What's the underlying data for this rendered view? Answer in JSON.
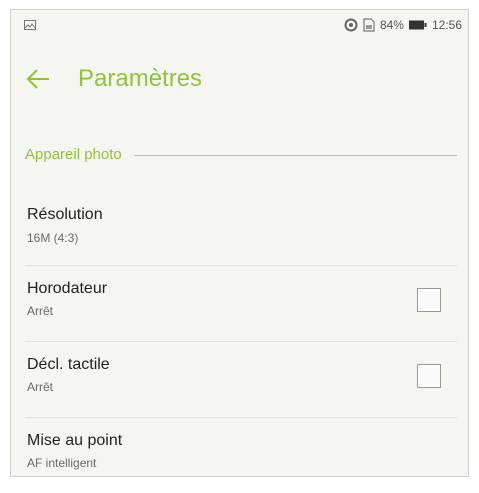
{
  "status_bar": {
    "battery_percent": "84%",
    "time": "12:56",
    "icons": [
      "image-notification-icon",
      "sync-icon",
      "sim-icon",
      "battery-icon"
    ]
  },
  "toolbar": {
    "title": "Paramètres",
    "back_icon": "arrow-left-icon"
  },
  "section": {
    "title": "Appareil photo"
  },
  "settings": [
    {
      "title": "Résolution",
      "value": "16M (4:3)"
    },
    {
      "title": "Horodateur",
      "value": "Arrêt",
      "checked": false
    },
    {
      "title": "Décl. tactile",
      "value": "Arrêt",
      "checked": false
    },
    {
      "title": "Mise au point",
      "value": "AF intelligent"
    }
  ],
  "colors": {
    "accent": "#8fc43a",
    "background": "#f5f5f2"
  }
}
